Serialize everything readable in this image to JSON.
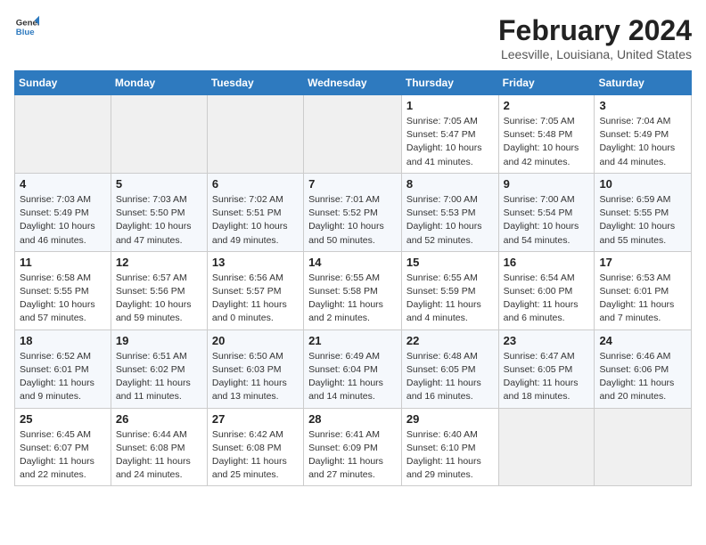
{
  "header": {
    "logo_general": "General",
    "logo_blue": "Blue",
    "month": "February 2024",
    "location": "Leesville, Louisiana, United States"
  },
  "weekdays": [
    "Sunday",
    "Monday",
    "Tuesday",
    "Wednesday",
    "Thursday",
    "Friday",
    "Saturday"
  ],
  "weeks": [
    [
      {
        "day": "",
        "info": ""
      },
      {
        "day": "",
        "info": ""
      },
      {
        "day": "",
        "info": ""
      },
      {
        "day": "",
        "info": ""
      },
      {
        "day": "1",
        "info": "Sunrise: 7:05 AM\nSunset: 5:47 PM\nDaylight: 10 hours and 41 minutes."
      },
      {
        "day": "2",
        "info": "Sunrise: 7:05 AM\nSunset: 5:48 PM\nDaylight: 10 hours and 42 minutes."
      },
      {
        "day": "3",
        "info": "Sunrise: 7:04 AM\nSunset: 5:49 PM\nDaylight: 10 hours and 44 minutes."
      }
    ],
    [
      {
        "day": "4",
        "info": "Sunrise: 7:03 AM\nSunset: 5:49 PM\nDaylight: 10 hours and 46 minutes."
      },
      {
        "day": "5",
        "info": "Sunrise: 7:03 AM\nSunset: 5:50 PM\nDaylight: 10 hours and 47 minutes."
      },
      {
        "day": "6",
        "info": "Sunrise: 7:02 AM\nSunset: 5:51 PM\nDaylight: 10 hours and 49 minutes."
      },
      {
        "day": "7",
        "info": "Sunrise: 7:01 AM\nSunset: 5:52 PM\nDaylight: 10 hours and 50 minutes."
      },
      {
        "day": "8",
        "info": "Sunrise: 7:00 AM\nSunset: 5:53 PM\nDaylight: 10 hours and 52 minutes."
      },
      {
        "day": "9",
        "info": "Sunrise: 7:00 AM\nSunset: 5:54 PM\nDaylight: 10 hours and 54 minutes."
      },
      {
        "day": "10",
        "info": "Sunrise: 6:59 AM\nSunset: 5:55 PM\nDaylight: 10 hours and 55 minutes."
      }
    ],
    [
      {
        "day": "11",
        "info": "Sunrise: 6:58 AM\nSunset: 5:55 PM\nDaylight: 10 hours and 57 minutes."
      },
      {
        "day": "12",
        "info": "Sunrise: 6:57 AM\nSunset: 5:56 PM\nDaylight: 10 hours and 59 minutes."
      },
      {
        "day": "13",
        "info": "Sunrise: 6:56 AM\nSunset: 5:57 PM\nDaylight: 11 hours and 0 minutes."
      },
      {
        "day": "14",
        "info": "Sunrise: 6:55 AM\nSunset: 5:58 PM\nDaylight: 11 hours and 2 minutes."
      },
      {
        "day": "15",
        "info": "Sunrise: 6:55 AM\nSunset: 5:59 PM\nDaylight: 11 hours and 4 minutes."
      },
      {
        "day": "16",
        "info": "Sunrise: 6:54 AM\nSunset: 6:00 PM\nDaylight: 11 hours and 6 minutes."
      },
      {
        "day": "17",
        "info": "Sunrise: 6:53 AM\nSunset: 6:01 PM\nDaylight: 11 hours and 7 minutes."
      }
    ],
    [
      {
        "day": "18",
        "info": "Sunrise: 6:52 AM\nSunset: 6:01 PM\nDaylight: 11 hours and 9 minutes."
      },
      {
        "day": "19",
        "info": "Sunrise: 6:51 AM\nSunset: 6:02 PM\nDaylight: 11 hours and 11 minutes."
      },
      {
        "day": "20",
        "info": "Sunrise: 6:50 AM\nSunset: 6:03 PM\nDaylight: 11 hours and 13 minutes."
      },
      {
        "day": "21",
        "info": "Sunrise: 6:49 AM\nSunset: 6:04 PM\nDaylight: 11 hours and 14 minutes."
      },
      {
        "day": "22",
        "info": "Sunrise: 6:48 AM\nSunset: 6:05 PM\nDaylight: 11 hours and 16 minutes."
      },
      {
        "day": "23",
        "info": "Sunrise: 6:47 AM\nSunset: 6:05 PM\nDaylight: 11 hours and 18 minutes."
      },
      {
        "day": "24",
        "info": "Sunrise: 6:46 AM\nSunset: 6:06 PM\nDaylight: 11 hours and 20 minutes."
      }
    ],
    [
      {
        "day": "25",
        "info": "Sunrise: 6:45 AM\nSunset: 6:07 PM\nDaylight: 11 hours and 22 minutes."
      },
      {
        "day": "26",
        "info": "Sunrise: 6:44 AM\nSunset: 6:08 PM\nDaylight: 11 hours and 24 minutes."
      },
      {
        "day": "27",
        "info": "Sunrise: 6:42 AM\nSunset: 6:08 PM\nDaylight: 11 hours and 25 minutes."
      },
      {
        "day": "28",
        "info": "Sunrise: 6:41 AM\nSunset: 6:09 PM\nDaylight: 11 hours and 27 minutes."
      },
      {
        "day": "29",
        "info": "Sunrise: 6:40 AM\nSunset: 6:10 PM\nDaylight: 11 hours and 29 minutes."
      },
      {
        "day": "",
        "info": ""
      },
      {
        "day": "",
        "info": ""
      }
    ]
  ]
}
